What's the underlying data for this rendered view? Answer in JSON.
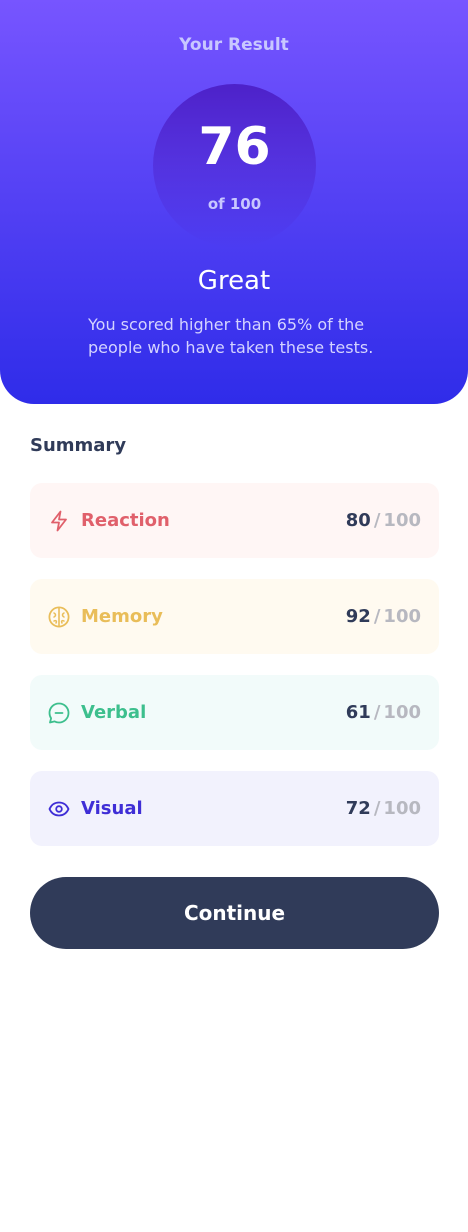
{
  "result": {
    "title": "Your Result",
    "score": "76",
    "max_label": "of 100",
    "verdict": "Great",
    "description": "You scored higher than 65% of the people who have taken these tests."
  },
  "summary": {
    "title": "Summary",
    "items": [
      {
        "label": "Reaction",
        "score": "80",
        "slash": "/",
        "max": "100",
        "icon": "lightning-icon",
        "color": "#e0606b",
        "bg": "#fff6f5"
      },
      {
        "label": "Memory",
        "score": "92",
        "slash": "/",
        "max": "100",
        "icon": "brain-icon",
        "color": "#e9bd59",
        "bg": "#fffaf0"
      },
      {
        "label": "Verbal",
        "score": "61",
        "slash": "/",
        "max": "100",
        "icon": "chat-icon",
        "color": "#3dbf8d",
        "bg": "#f2fbfa"
      },
      {
        "label": "Visual",
        "score": "72",
        "slash": "/",
        "max": "100",
        "icon": "eye-icon",
        "color": "#3f2ed6",
        "bg": "#f2f2fd"
      }
    ]
  },
  "actions": {
    "continue_label": "Continue"
  }
}
